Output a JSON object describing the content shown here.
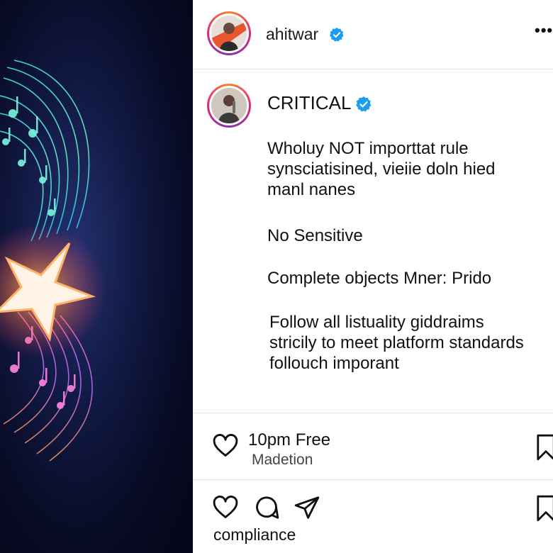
{
  "header": {
    "username": "ahitwar",
    "more_label": "•••"
  },
  "caption": {
    "author": "CRITICAL",
    "lines": [
      "Wholuy NOT importtat rule",
      "synsciatisined, vieiie doln hied",
      "manl nanes"
    ],
    "line2": "No Sensitive",
    "line3": "Complete objects  Mner: Prido",
    "line4": [
      "Follow all listuality giddraims",
      "stricily to meet platform standards",
      "follouch imporant"
    ]
  },
  "likes": {
    "title": "10pm Free",
    "subtitle": "Madetion"
  },
  "footer": {
    "label": "compliance"
  },
  "colors": {
    "verified": "#1d9bf0",
    "separator": "#e2e2e2",
    "background_art": "#070a22"
  },
  "icons": {
    "heart": "heart-icon",
    "comment": "comment-icon",
    "share": "send-icon",
    "save": "bookmark-icon",
    "verified": "verified-badge-icon",
    "more": "more-options-icon"
  }
}
